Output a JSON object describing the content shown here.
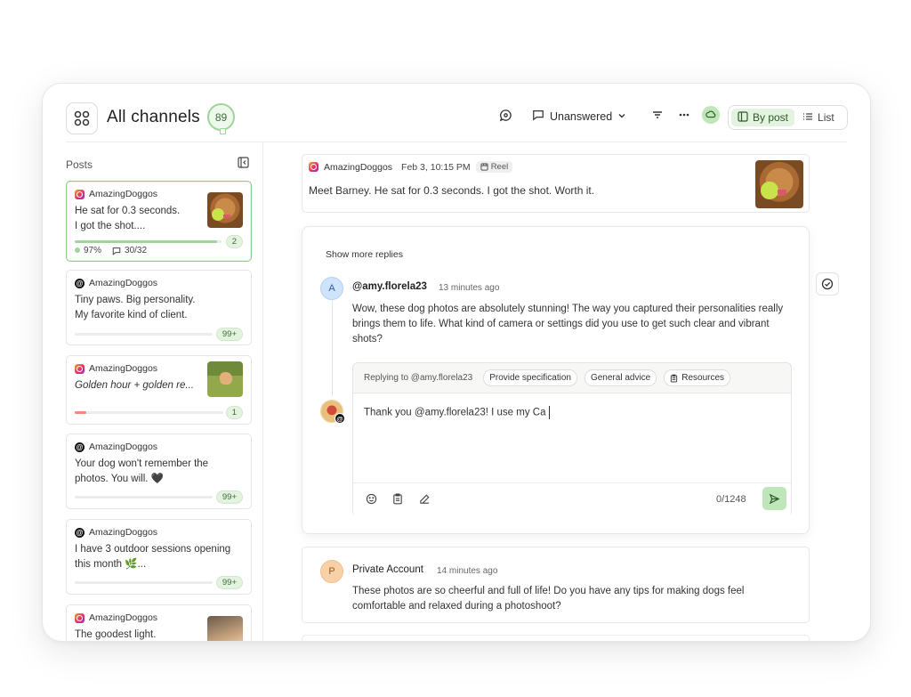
{
  "header": {
    "title": "All channels",
    "count": "89",
    "filter_label": "Unanswered",
    "view_by_post": "By post",
    "view_list": "List"
  },
  "sidebar": {
    "title": "Posts",
    "posts": [
      {
        "account": "AmazingDoggos",
        "platform": "instagram",
        "text": "He sat for 0.3 seconds.\n I got the shot....",
        "badge": "2",
        "progress": 0.97,
        "progress_label": "97%",
        "replies": "30/32",
        "selected": true
      },
      {
        "account": "AmazingDoggos",
        "platform": "threads",
        "text": "Tiny paws. Big personality.\n My favorite kind of client.",
        "badge": "99+"
      },
      {
        "account": "AmazingDoggos",
        "platform": "instagram",
        "text": "Golden hour + golden re...",
        "badge": "1",
        "progress": 0.08
      },
      {
        "account": "AmazingDoggos",
        "platform": "threads",
        "text": "Your dog won't remember the photos. You will. 🖤",
        "badge": "99+"
      },
      {
        "account": "AmazingDoggos",
        "platform": "threads",
        "text": "I have 3 outdoor sessions opening this month 🌿...",
        "badge": "99+"
      },
      {
        "account": "AmazingDoggos",
        "platform": "instagram",
        "text": "The goodest light."
      }
    ]
  },
  "post_preview": {
    "account": "AmazingDoggos",
    "date": "Feb 3, 10:15 PM",
    "type": "Reel",
    "text": "Meet Barney. He sat for 0.3 seconds. I got the shot. Worth it."
  },
  "thread": {
    "show_more": "Show more replies",
    "comment": {
      "avatar_letter": "A",
      "user": "@amy.florela23",
      "time": "13 minutes ago",
      "text": "Wow, these dog photos are absolutely stunning! The way you captured their personalities really brings them to life. What kind of camera or settings did you use to get such clear and vibrant shots?"
    },
    "reply": {
      "replying_to": "Replying to @amy.florela23",
      "chips": [
        "Provide specification",
        "General advice",
        "Resources"
      ],
      "draft": "Thank you @amy.florela23! I use my Ca",
      "char_count": "0/1248"
    }
  },
  "comment2": {
    "avatar_letter": "P",
    "user": "Private Account",
    "time": "14 minutes ago",
    "text": "These photos are so cheerful and full of life! Do you have any tips for making dogs feel comfortable and relaxed during a photoshoot?"
  },
  "colors": {
    "accent_green": "#9fd49a",
    "badge_bg": "#e3f3df",
    "progress_red": "#f08a7a"
  }
}
